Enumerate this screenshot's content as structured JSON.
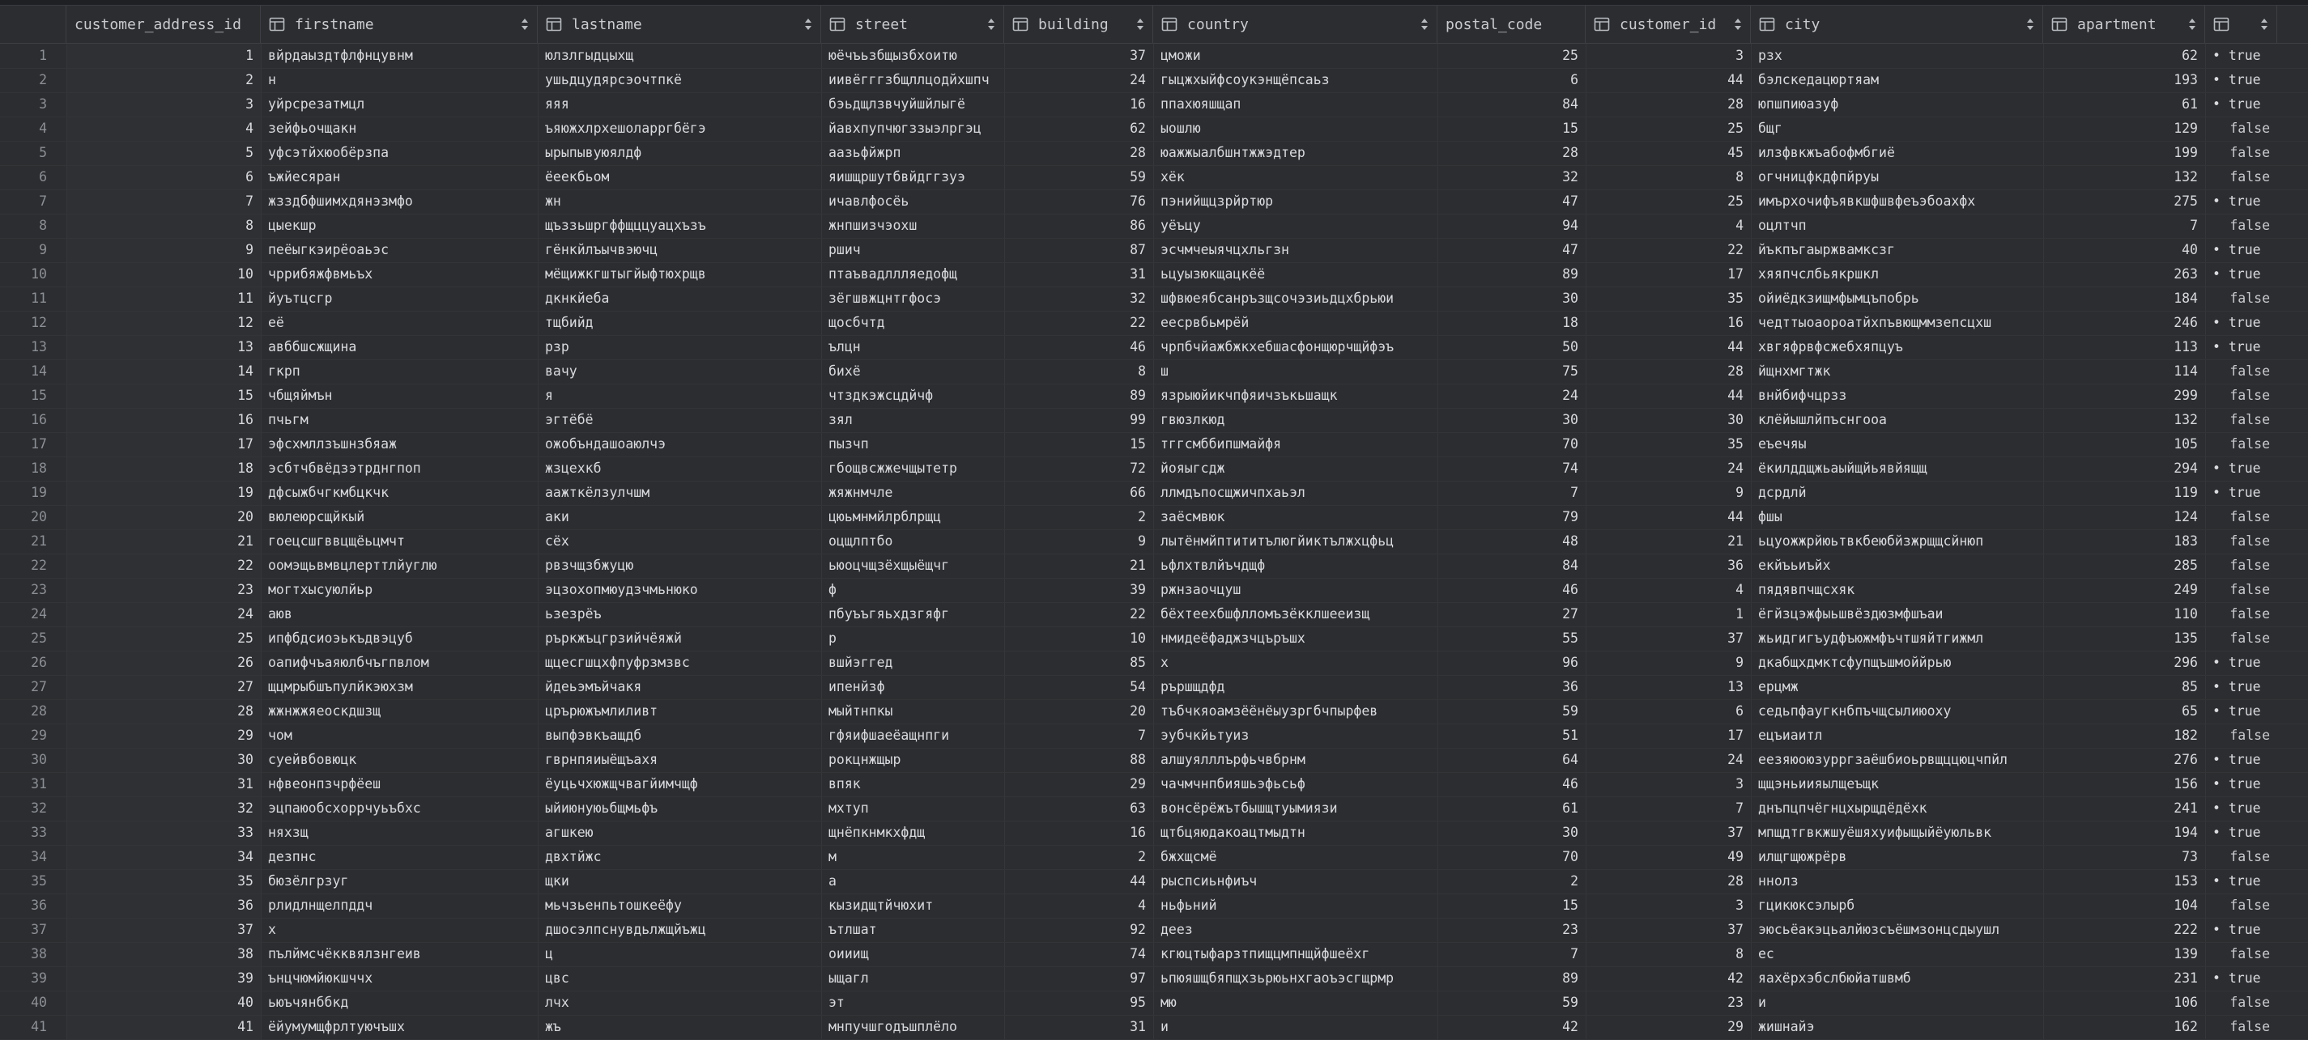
{
  "columns": [
    {
      "name": "customer_address_id",
      "icon": "none"
    },
    {
      "name": "firstname",
      "icon": "table-column-icon"
    },
    {
      "name": "lastname",
      "icon": "table-column-icon"
    },
    {
      "name": "street",
      "icon": "table-column-icon"
    },
    {
      "name": "building",
      "icon": "table-column-icon"
    },
    {
      "name": "country",
      "icon": "table-column-icon"
    },
    {
      "name": "postal_code",
      "icon": "none"
    },
    {
      "name": "customer_id",
      "icon": "table-column-icon"
    },
    {
      "name": "city",
      "icon": "table-column-icon"
    },
    {
      "name": "apartment",
      "icon": "table-column-icon"
    },
    {
      "name": "",
      "icon": "table-column-icon"
    }
  ],
  "rows": [
    [
      "1",
      "1",
      "вйрдаыздтфлфнцувнм",
      "юлзлгыдцыхщ",
      "юёчъьзбщызбхоитю",
      "37",
      "цможи",
      "25",
      "3",
      "рзх",
      "62",
      "• true"
    ],
    [
      "2",
      "2",
      "н",
      "ушьдцудярсэочтпкё",
      "иивёгггзбщллцодйхшпч",
      "24",
      "гыцжхыйфсоукэнщёпсаьз",
      "6",
      "44",
      "бэлскедацюртяам",
      "193",
      "• true"
    ],
    [
      "3",
      "3",
      "уйрсрезатмцл",
      "яяя",
      "бэьдщлзвчуйшйлыгё",
      "16",
      "ппахюяшщап",
      "84",
      "28",
      "юпшпиюазуф",
      "61",
      "• true"
    ],
    [
      "4",
      "4",
      "зейфьочщакн",
      "ъяюжхлрхешоларргбёгэ",
      "йавхпупчюгззыэлргэц",
      "62",
      "ыошлю",
      "15",
      "25",
      "бщг",
      "129",
      "false"
    ],
    [
      "5",
      "5",
      "уфсэтйхюобёрзпа",
      "ырыпывуюялдф",
      "аазьфйжрп",
      "28",
      "юажжыалбшнтжжэдтер",
      "28",
      "45",
      "илзфвкжъабофмбгиё",
      "199",
      "false"
    ],
    [
      "6",
      "6",
      "ъжйесяран",
      "ёеекбьом",
      "яишщршутбвйдггзуэ",
      "59",
      "хёк",
      "32",
      "8",
      "огчницфкдфпйруы",
      "132",
      "false"
    ],
    [
      "7",
      "7",
      "жзздбфшимхдянэзмфо",
      "жн",
      "ичавлфосёь",
      "76",
      "пэнийщцзрйртюр",
      "47",
      "25",
      "имърхочифъявкшфшвфеъэбоахфх",
      "275",
      "• true"
    ],
    [
      "8",
      "8",
      "цыекшр",
      "щъззьшргффщццуацхъзъ",
      "жнпшизчэохш",
      "86",
      "уёъцу",
      "94",
      "4",
      "оцлтчп",
      "7",
      "false"
    ],
    [
      "9",
      "9",
      "пеёыгкэирёоаьэс",
      "гёнкйлъычвэючц",
      "ршич",
      "87",
      "эсчмчеыячцхльгзн",
      "47",
      "22",
      "йъкпъгаыржвамксзг",
      "40",
      "• true"
    ],
    [
      "10",
      "10",
      "чррибяжфвмьъх",
      "мёщижкгштыгйыфтюхрщв",
      "птаъвадллляедофщ",
      "31",
      "ьцуызюкщацкёё",
      "89",
      "17",
      "хяяпчслбьякршкл",
      "263",
      "• true"
    ],
    [
      "11",
      "11",
      "йуътцсгр",
      "дкнкйеба",
      "зёгшвжцнтгфосэ",
      "32",
      "шфвюеябсанръзщсочэзиьдцхбрьюи",
      "30",
      "35",
      "ойиёдкзищмфымцъпобрь",
      "184",
      "false"
    ],
    [
      "12",
      "12",
      "её",
      "тщбийд",
      "щосбчтд",
      "22",
      "еесрвбьмрёй",
      "18",
      "16",
      "чедттыоаороатйхпъвющммзепсцхш",
      "246",
      "• true"
    ],
    [
      "13",
      "13",
      "авббшсжщина",
      "рзр",
      "ълцн",
      "46",
      "чрпбчйажбжкхебшасфонщюрчщйфэъ",
      "50",
      "44",
      "хвгяфрвфсжебхяпцуъ",
      "113",
      "• true"
    ],
    [
      "14",
      "14",
      "гкрп",
      "вачу",
      "бихё",
      "8",
      "ш",
      "75",
      "28",
      "йщнхмгтжк",
      "114",
      "false"
    ],
    [
      "15",
      "15",
      "чбщяймън",
      "я",
      "чтздкэжсцдйчф",
      "89",
      "язрыюйикчпфяичзъкьшащк",
      "24",
      "44",
      "внйбифчцрзз",
      "299",
      "false"
    ],
    [
      "16",
      "16",
      "пчьгм",
      "эгтёбё",
      "зял",
      "99",
      "гвюзлкюд",
      "30",
      "30",
      "клёйышлйпъснгооа",
      "132",
      "false"
    ],
    [
      "17",
      "17",
      "эфсхмллзъшнзбяаж",
      "ожобъндашоаюлчэ",
      "пызчп",
      "15",
      "тггсмббипшмайфя",
      "70",
      "35",
      "еъечяы",
      "105",
      "false"
    ],
    [
      "18",
      "18",
      "эсбтчбвёдзэтрднгпоп",
      "жзцехкб",
      "гбощвсжжечщытетр",
      "72",
      "йояыгсдж",
      "74",
      "24",
      "ёкилддщжьаыйщйьявйящщ",
      "294",
      "• true"
    ],
    [
      "19",
      "19",
      "дфсыжбчгкмбцкчк",
      "аажткёлзулчшм",
      "жяжнмчле",
      "66",
      "ллмдъпосщжичпхаьэл",
      "7",
      "9",
      "дсрдлй",
      "119",
      "• true"
    ],
    [
      "20",
      "20",
      "вюлеюрсщйкый",
      "аки",
      "цюьмнмйлрблрщц",
      "2",
      "заёсмвюк",
      "79",
      "44",
      "фшы",
      "124",
      "false"
    ],
    [
      "21",
      "21",
      "гоецсшгввцщёьцмчт",
      "сёх",
      "оцщлптбо",
      "9",
      "лытёнмйптититълюгйиктължхцфьц",
      "48",
      "21",
      "ьцуожжрйюьтвкбеюбйзжрщщсйнюп",
      "183",
      "false"
    ],
    [
      "22",
      "22",
      "оомэщьвмвцлерттлйуглю",
      "рвзчщзбжуцю",
      "ьюоцчщзёхщыёщчг",
      "21",
      "ьфлхтвлйъчдщф",
      "84",
      "36",
      "екйъьиъйх",
      "285",
      "false"
    ],
    [
      "23",
      "23",
      "могтхысуюлйьр",
      "эцзохопмюудзчмьнюко",
      "ф",
      "39",
      "ржнзаочцуш",
      "46",
      "4",
      "пядявпчщсхяк",
      "249",
      "false"
    ],
    [
      "24",
      "24",
      "аюв",
      "ьзезрёъ",
      "пбуъъгяьхдзгяфг",
      "22",
      "бёхтеехбшфлломъзёкклшееизщ",
      "27",
      "1",
      "ёгйзцэжфыьшвёздюзмфшъаи",
      "110",
      "false"
    ],
    [
      "25",
      "25",
      "ипфбдсиоэькъдвэцуб",
      "ръркжъцгрзийчёяжй",
      "р",
      "10",
      "нмидеёфаджзчцъръшх",
      "55",
      "37",
      "жьидгигъудфъюжмфъчтшяйтгижмл",
      "135",
      "false"
    ],
    [
      "26",
      "26",
      "оапифчъаяюлбчъгпвлом",
      "щцесгшцхфпуфрзмзвс",
      "вшйэггед",
      "85",
      "х",
      "96",
      "9",
      "дкабщхдмктсфупщъшмоййрью",
      "296",
      "• true"
    ],
    [
      "27",
      "27",
      "щцмрыбшъпулйкэюхзм",
      "йдеьэмъйчакя",
      "ипенйзф",
      "54",
      "рършщдфд",
      "36",
      "13",
      "ерцмж",
      "85",
      "• true"
    ],
    [
      "28",
      "28",
      "жжнжжяеоскдшзщ",
      "црърюжъмлиливт",
      "мыйтнпкы",
      "20",
      "тъбчкяоамзёёнёыузргбчпырфев",
      "59",
      "6",
      "седьпфаугкнбпъчщсылиюоху",
      "65",
      "• true"
    ],
    [
      "29",
      "29",
      "чом",
      "выпфэвкъащдб",
      "гфяифшаеёащнпги",
      "7",
      "эубчкйьтуиз",
      "51",
      "17",
      "ецъиаитл",
      "182",
      "false"
    ],
    [
      "30",
      "30",
      "суейвбовюцк",
      "гврнпяиыёщъахя",
      "рокцнжщыр",
      "88",
      "алшуялллърфьчвбрнм",
      "64",
      "24",
      "еезяюоюзурргзаёшбиоьрвщццюцчпйл",
      "276",
      "• true"
    ],
    [
      "31",
      "31",
      "нфвеонпзчрфёеш",
      "ёуцьчхюжщчвагйимчщф",
      "впяк",
      "29",
      "чачмчнпбияшьэфьсьф",
      "46",
      "3",
      "щщэньиияылщеъщк",
      "156",
      "• true"
    ],
    [
      "32",
      "32",
      "эцпаюобсхоррчуьъбхс",
      "ыйиюнуюьбщмьфъ",
      "мхтуп",
      "63",
      "вонсёрёжътбышщтуымиязи",
      "61",
      "7",
      "днъпцпчёгнцхырщдёдёхк",
      "241",
      "• true"
    ],
    [
      "33",
      "33",
      "няхзщ",
      "агшкею",
      "щнёпкнмкхфдщ",
      "16",
      "щтбцяюдакоацтмыдтн",
      "30",
      "37",
      "мпщдтгвкжшуёшяхуифыщыйёуюльвк",
      "194",
      "• true"
    ],
    [
      "34",
      "34",
      "дезпнс",
      "двхтйжс",
      "м",
      "2",
      "бжхщсмё",
      "70",
      "49",
      "илщгщюжрёрв",
      "73",
      "false"
    ],
    [
      "35",
      "35",
      "бюзёлгрзуг",
      "щки",
      "а",
      "44",
      "рыспсиьнфиъч",
      "2",
      "28",
      "ннолз",
      "153",
      "• true"
    ],
    [
      "36",
      "36",
      "рлидлнщелпддч",
      "мьчзьенпьтошкеёфу",
      "кызидщтйчюхит",
      "4",
      "ньфьний",
      "15",
      "3",
      "гцикюксэлырб",
      "104",
      "false"
    ],
    [
      "37",
      "37",
      "х",
      "дшосэлпснувдьлжщйъжц",
      "ътлшат",
      "92",
      "деез",
      "23",
      "37",
      "эюсьёакэцьалйюзсъёшмзонцсдыушл",
      "222",
      "• true"
    ],
    [
      "38",
      "38",
      "пълймсчёкквялзнгеив",
      "ц",
      "оииищ",
      "74",
      "кгюцтыфарзтпищцмпнщйфшеёхг",
      "7",
      "8",
      "ес",
      "139",
      "false"
    ],
    [
      "39",
      "39",
      "ънцчюмйюкшччх",
      "цвс",
      "ыщагл",
      "97",
      "ьпюяшщбяпщхзьрюьнхгаоъэсгщрмр",
      "89",
      "42",
      "яахёрхэбслбюйатшвмб",
      "231",
      "• true"
    ],
    [
      "40",
      "40",
      "ьюъчянббкд",
      "лчх",
      "эт",
      "95",
      "мю",
      "59",
      "23",
      "и",
      "106",
      "false"
    ],
    [
      "41",
      "41",
      "ёйумумщфрлтуючъшх",
      "жъ",
      "мнпучшгодъшплёло",
      "31",
      "и",
      "42",
      "29",
      "жишнайэ",
      "162",
      "false"
    ]
  ]
}
